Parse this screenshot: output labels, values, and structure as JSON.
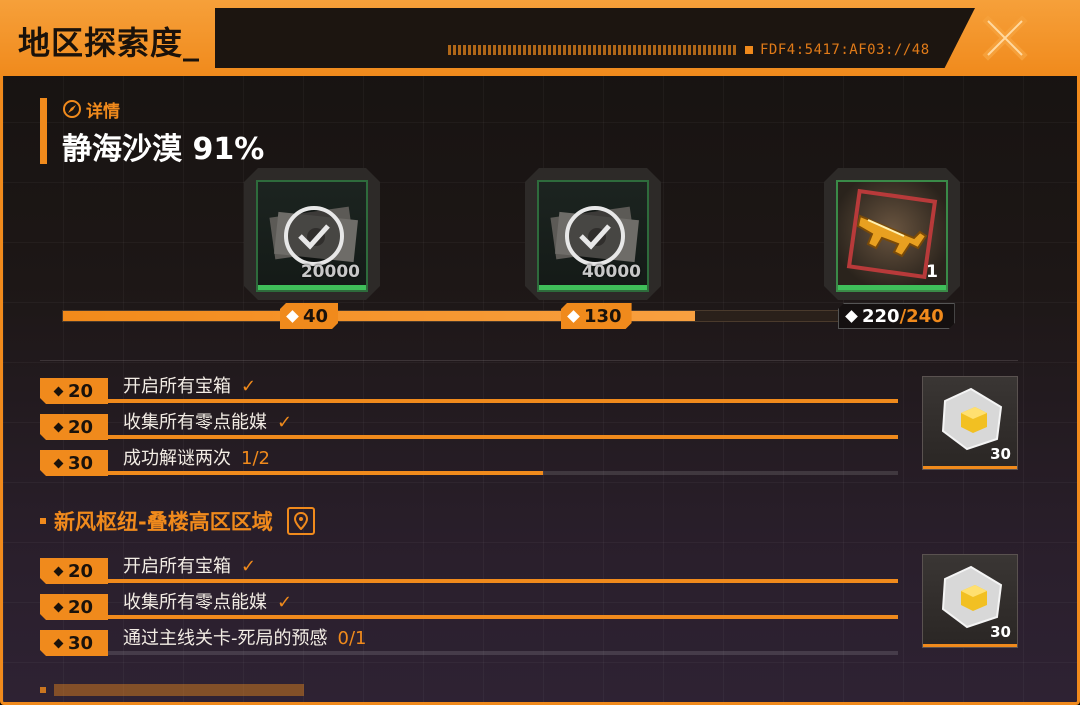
{
  "window": {
    "title": "地区探索度_",
    "code": "FDF4:5417:AF03://48",
    "accent": "#f08a1c"
  },
  "detail": {
    "label": "详情",
    "region_name": "静海沙漠 91%"
  },
  "progress": {
    "current": 220,
    "max": 240,
    "fraction": 0.917,
    "current_label": "220",
    "max_label": "240"
  },
  "milestones": [
    {
      "value": "40",
      "reward_amount": "20000",
      "claimed": true
    },
    {
      "value": "130",
      "reward_amount": "40000",
      "claimed": true
    },
    {
      "value": "220/240",
      "reward_qty": "1",
      "claimed": false,
      "icon": "golden-smg"
    }
  ],
  "sections": [
    {
      "name": "",
      "reward_qty": "30",
      "tasks": [
        {
          "points": "20",
          "label": "开启所有宝箱",
          "done": true,
          "progress": "",
          "fill": 1.0
        },
        {
          "points": "20",
          "label": "收集所有零点能媒",
          "done": true,
          "progress": "",
          "fill": 1.0
        },
        {
          "points": "30",
          "label": "成功解谜两次",
          "done": false,
          "progress": "1/2",
          "fill": 0.5
        }
      ]
    },
    {
      "name": "新风枢纽-叠楼高区区域",
      "reward_qty": "30",
      "tasks": [
        {
          "points": "20",
          "label": "开启所有宝箱",
          "done": true,
          "progress": "",
          "fill": 1.0
        },
        {
          "points": "20",
          "label": "收集所有零点能媒",
          "done": true,
          "progress": "",
          "fill": 1.0
        },
        {
          "points": "30",
          "label": "通过主线关卡-死局的预感",
          "done": false,
          "progress": "0/1",
          "fill": 0.0
        }
      ]
    }
  ]
}
